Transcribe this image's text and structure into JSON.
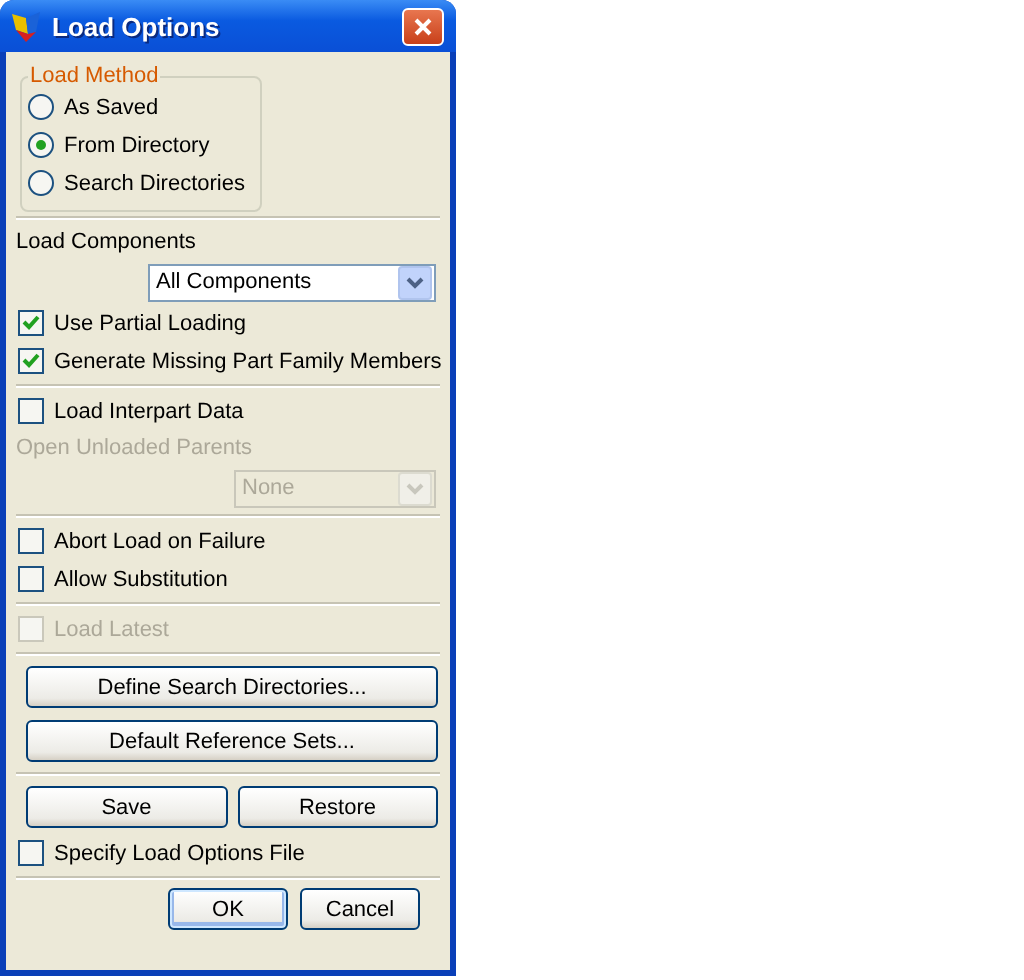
{
  "window": {
    "title": "Load Options"
  },
  "load_method": {
    "label": "Load Method",
    "options": [
      {
        "label": "As Saved",
        "selected": false
      },
      {
        "label": "From Directory",
        "selected": true
      },
      {
        "label": "Search Directories",
        "selected": false
      }
    ]
  },
  "groups": [
    [
      {
        "kind": "label",
        "text": "Load Components",
        "disabled": false
      },
      {
        "kind": "dropdown",
        "value": "All Components",
        "disabled": false
      },
      {
        "kind": "checkbox",
        "label": "Use Partial Loading",
        "checked": true,
        "disabled": false
      },
      {
        "kind": "checkbox",
        "label": "Generate Missing Part Family Members",
        "checked": true,
        "disabled": false
      }
    ],
    [
      {
        "kind": "checkbox",
        "label": "Load Interpart Data",
        "checked": false,
        "disabled": false
      },
      {
        "kind": "label",
        "text": "Open Unloaded Parents",
        "disabled": true
      },
      {
        "kind": "dropdown",
        "value": "None",
        "disabled": true
      }
    ],
    [
      {
        "kind": "checkbox",
        "label": "Abort Load on Failure",
        "checked": false,
        "disabled": false
      },
      {
        "kind": "checkbox",
        "label": "Allow Substitution",
        "checked": false,
        "disabled": false
      }
    ],
    [
      {
        "kind": "checkbox",
        "label": "Load Latest",
        "checked": false,
        "disabled": true
      }
    ],
    [
      {
        "kind": "buttons",
        "buttons": [
          "Define Search Directories..."
        ]
      },
      {
        "kind": "buttons",
        "buttons": [
          "Default Reference Sets..."
        ]
      }
    ],
    [
      {
        "kind": "buttons",
        "buttons": [
          "Save",
          "Restore"
        ]
      },
      {
        "kind": "checkbox",
        "label": "Specify Load Options File",
        "checked": false,
        "disabled": false
      }
    ]
  ],
  "footer": [
    {
      "label": "OK",
      "default": true
    },
    {
      "label": "Cancel",
      "default": false
    }
  ]
}
